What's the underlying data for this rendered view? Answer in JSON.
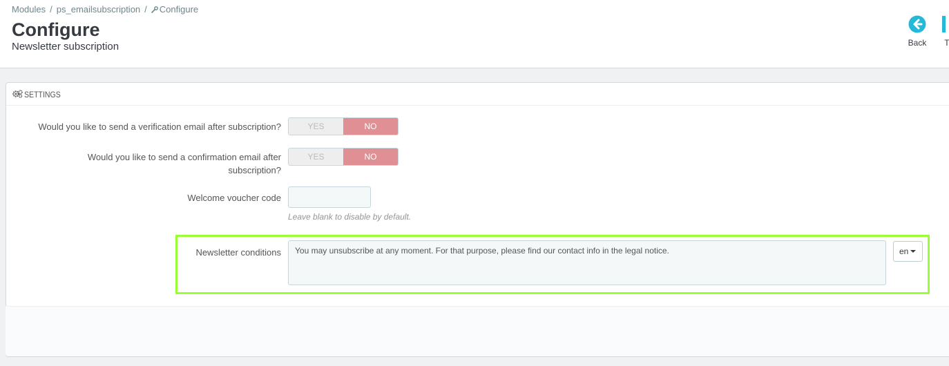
{
  "breadcrumb": {
    "items": [
      "Modules",
      "ps_emailsubscription"
    ],
    "current": "Configure",
    "separator": "/"
  },
  "header": {
    "title": "Configure",
    "subtitle": "Newsletter subscription"
  },
  "toolbar": {
    "back_label": "Back",
    "translate_label": "Tra"
  },
  "panel": {
    "heading": "SETTINGS"
  },
  "form": {
    "verification_email": {
      "label": "Would you like to send a verification email after subscription?",
      "yes": "YES",
      "no": "NO",
      "selected": "NO"
    },
    "confirmation_email": {
      "label_line1": "Would you like to send a confirmation email after",
      "label_line2": "subscription?",
      "yes": "YES",
      "no": "NO",
      "selected": "NO"
    },
    "voucher": {
      "label": "Welcome voucher code",
      "value": "",
      "help": "Leave blank to disable by default."
    },
    "conditions": {
      "label": "Newsletter conditions",
      "value": "You may unsubscribe at any moment. For that purpose, please find our contact info in the legal notice.",
      "language": "en"
    }
  },
  "colors": {
    "accent": "#25b9d7",
    "switch_no": "#e08f95",
    "highlight": "#99ff33"
  }
}
